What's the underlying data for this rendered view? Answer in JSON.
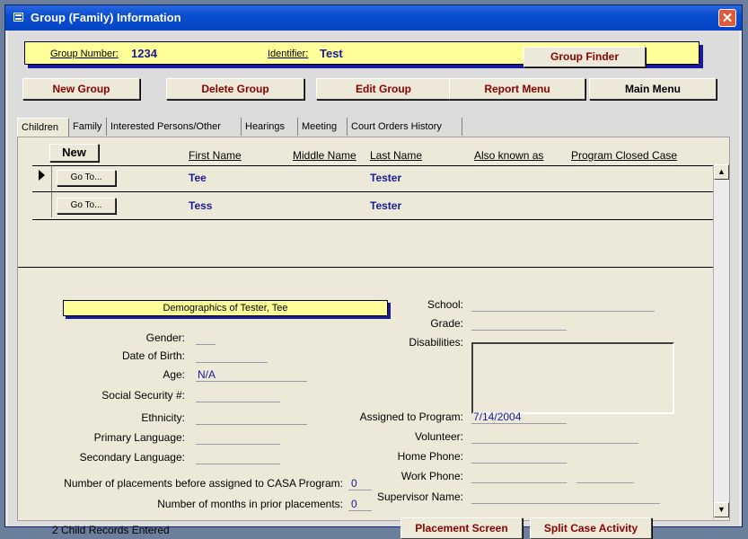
{
  "window": {
    "title": "Group (Family) Information",
    "close_glyph": "✕"
  },
  "header": {
    "group_number_label": "Group Number:",
    "group_number_value": "1234",
    "identifier_label": "Identifier:",
    "identifier_value": "Test",
    "group_finder_label": "Group Finder"
  },
  "toolbar": {
    "new_group": "New Group",
    "delete_group": "Delete Group",
    "edit_group": "Edit Group",
    "report_menu": "Report Menu",
    "main_menu": "Main Menu"
  },
  "tabs": [
    "Children",
    "Family",
    "Interested Persons/Other",
    "Hearings",
    "Meeting",
    "Court Orders History"
  ],
  "children": {
    "new_button": "New",
    "columns": [
      "First Name",
      "Middle Name",
      "Last Name",
      "Also known as",
      "Program Closed Case"
    ],
    "goto_label": "Go To...",
    "rows": [
      {
        "first": "Tee",
        "middle": "",
        "last": "Tester",
        "aka": "",
        "closed": ""
      },
      {
        "first": "Tess",
        "middle": "",
        "last": "Tester",
        "aka": "",
        "closed": ""
      }
    ]
  },
  "demographics": {
    "title": "Demographics of Tester, Tee",
    "gender_label": "Gender:",
    "dob_label": "Date of Birth:",
    "age_label": "Age:",
    "age_value": "N/A",
    "ssn_label": "Social Security #:",
    "ethnicity_label": "Ethnicity:",
    "primary_language_label": "Primary Language:",
    "secondary_language_label": "Secondary Language:",
    "placements_label": "Number of placements before assigned to CASA Program:",
    "placements_value": "0",
    "months_label": "Number of months in prior placements:",
    "months_value": "0",
    "school_label": "School:",
    "grade_label": "Grade:",
    "disabilities_label": "Disabilities:",
    "assigned_label": "Assigned to Program:",
    "assigned_value": "7/14/2004",
    "volunteer_label": "Volunteer:",
    "home_phone_label": "Home Phone:",
    "work_phone_label": "Work Phone:",
    "supervisor_label": "Supervisor Name:"
  },
  "footer": {
    "records_text": "2 Child Records Entered",
    "placement_button": "Placement Screen",
    "split_button": "Split Case Activity"
  },
  "colors": {
    "title_bar": "#0a4ed0",
    "highlight": "#ffff99",
    "accent_text": "#1a1a9a",
    "button_text": "#8b0000"
  }
}
